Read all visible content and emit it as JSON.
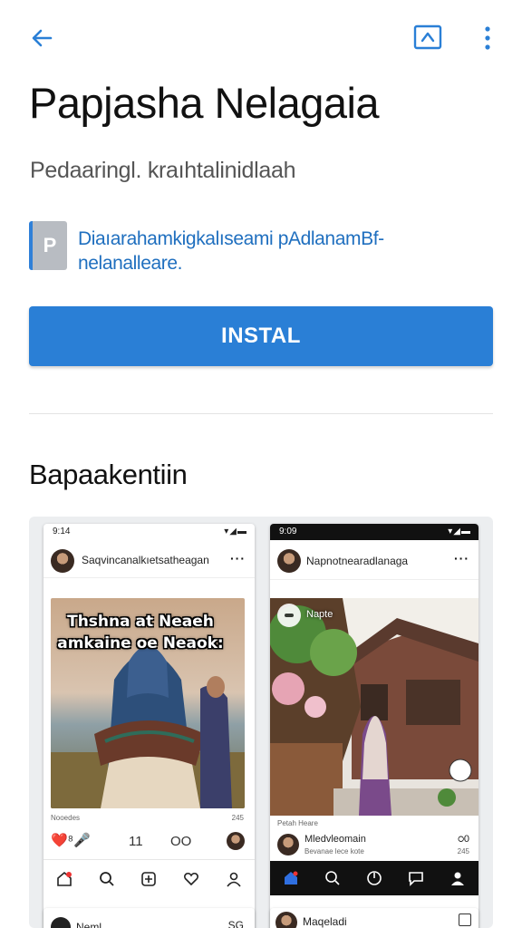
{
  "colors": {
    "accent": "#2a7fd6",
    "link": "#1f6fbf",
    "background": "#ffffff"
  },
  "topbar": {
    "back_icon": "arrow-left-icon",
    "external_icon": "open-external-icon",
    "more_icon": "more-vertical-icon"
  },
  "app": {
    "title": "Papjasha Nelagaia",
    "subtitle": "Pedaaringl. kraıhtalinidlaah",
    "publisher_logo_letter": "P",
    "publisher_text": "Diaıаrahamkigkalıseami pAdlanamBf- nelanalleare."
  },
  "install_button": {
    "label": "INSTAL"
  },
  "screenshots_section": {
    "title": "Bapaakentiin",
    "phone1": {
      "status_time": "9:14",
      "status_icons": "▾◢▬",
      "username": "Saqvincanalkıetsatheagan",
      "more": "···",
      "overlay_text": "Thshna at Neaeh amkaine oe Neaok:",
      "caption": "Nooedes",
      "count": "245",
      "reaction_icons": "❤️⁸🎤",
      "stat1": "11",
      "stat2": "ОО",
      "nav": [
        "home-icon",
        "search-icon",
        "add-post-icon",
        "heart-icon",
        "profile-icon"
      ]
    },
    "phone2": {
      "status_time": "9:09",
      "status_icons": "▾◢▬",
      "username": "Napnotnearadlanaga",
      "more": "···",
      "tag_text": "Napte",
      "caption_head": "Petah Heare",
      "comment_name": "Mledvleomain",
      "comment_sub": "Bevanae lece kote",
      "comment_icon": "ഠ0",
      "comment_num": "245",
      "nav": [
        "home-icon",
        "search-icon",
        "compass-icon",
        "message-icon",
        "profile-icon"
      ]
    },
    "peek1": {
      "name": "Neml",
      "icon": "SG"
    },
    "peek2": {
      "name": "Maqeladi"
    }
  }
}
